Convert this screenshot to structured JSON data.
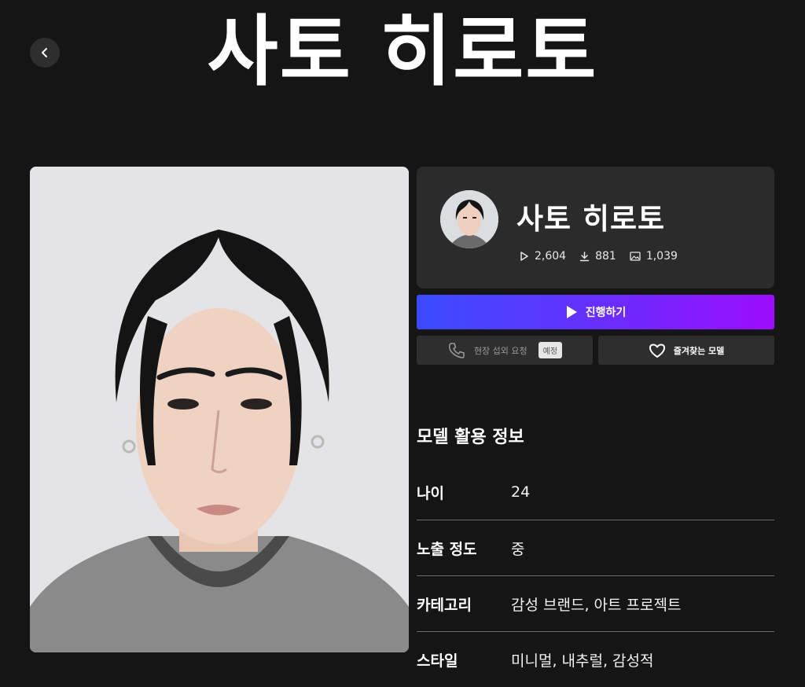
{
  "header": {
    "title": "사토 히로토",
    "back_icon": "chevron-left-icon"
  },
  "profile": {
    "name": "사토 히로토",
    "stats": {
      "plays": "2,604",
      "downloads": "881",
      "images": "1,039"
    }
  },
  "actions": {
    "proceed_label": "진행하기",
    "onsite_label": "현장 섭외 요청",
    "onsite_badge": "예정",
    "favorite_label": "즐겨찾는 모델"
  },
  "info": {
    "title": "모델 활용 정보",
    "rows": [
      {
        "label": "나이",
        "value": "24"
      },
      {
        "label": "노출 정도",
        "value": "중"
      },
      {
        "label": "카테고리",
        "value": "감성 브랜드, 아트 프로젝트"
      },
      {
        "label": "스타일",
        "value": "미니멀, 내추럴, 감성적"
      }
    ]
  },
  "colors": {
    "background": "#151515",
    "card": "#2b2b2b",
    "gradient_start": "#3a4bff",
    "gradient_end": "#9d0cff"
  }
}
